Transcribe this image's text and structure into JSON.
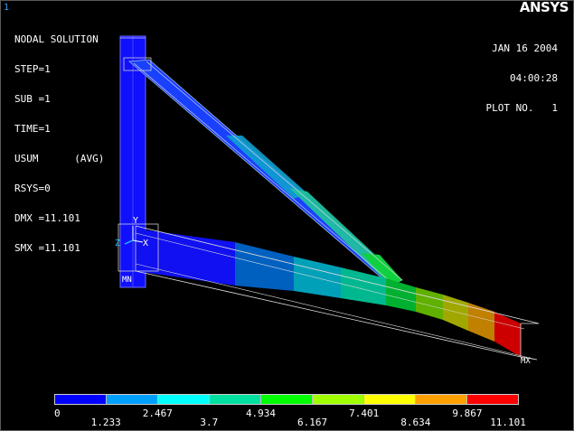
{
  "window_number": "1",
  "logo": {
    "text": "ANSYS"
  },
  "info": {
    "title": "NODAL SOLUTION",
    "step": "STEP=1",
    "sub": "SUB =1",
    "time": "TIME=1",
    "usum": "USUM      (AVG)",
    "rsys": "RSYS=0",
    "dmx": "DMX =11.101",
    "smx": "SMX =11.101"
  },
  "date": {
    "date": "JAN 16 2004",
    "time": "04:00:28",
    "plot": "PLOT NO.   1"
  },
  "markers": {
    "min": "MN",
    "max": "MX",
    "axis_x": "X",
    "axis_y": "Y",
    "axis_z": "Z"
  },
  "legend": {
    "colors": [
      "#0000ff",
      "#00a0ff",
      "#00ffff",
      "#00e0a0",
      "#00ff00",
      "#a0ff00",
      "#ffff00",
      "#ffa000",
      "#ff0000"
    ],
    "labels_bottom_row1": [
      "0",
      "2.467",
      "4.934",
      "7.401",
      "9.867"
    ],
    "labels_bottom_row2": [
      "1.233",
      "3.7",
      "6.167",
      "8.634",
      "11.101"
    ]
  }
}
